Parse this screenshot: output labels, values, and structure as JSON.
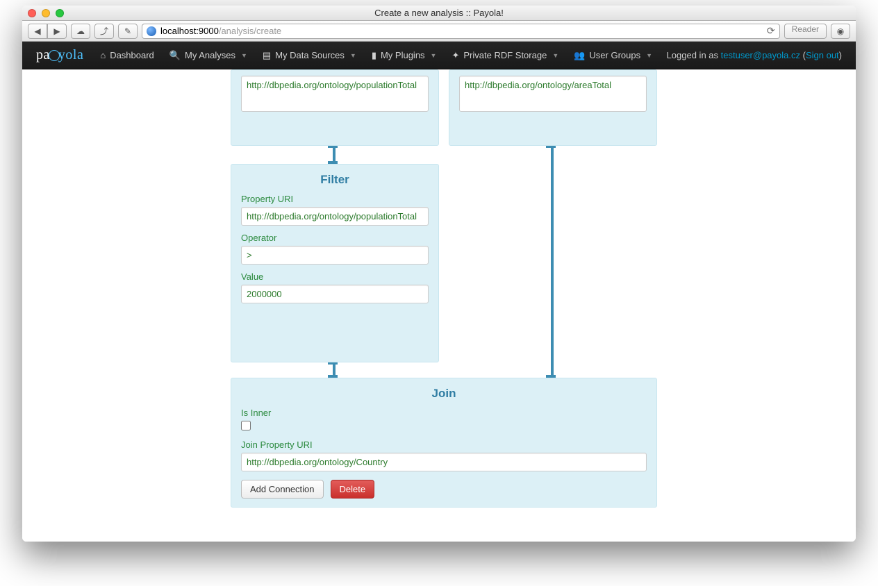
{
  "window": {
    "title": "Create a new analysis :: Payola!",
    "url_host": "localhost:9000",
    "url_path": "/analysis/create",
    "reader_label": "Reader"
  },
  "navbar": {
    "brand": "payola",
    "items": [
      {
        "icon": "home",
        "label": "Dashboard",
        "has_dropdown": false
      },
      {
        "icon": "search",
        "label": "My Analyses",
        "has_dropdown": true
      },
      {
        "icon": "folder",
        "label": "My Data Sources",
        "has_dropdown": true
      },
      {
        "icon": "file",
        "label": "My Plugins",
        "has_dropdown": true
      },
      {
        "icon": "share",
        "label": "Private RDF Storage",
        "has_dropdown": true
      },
      {
        "icon": "users",
        "label": "User Groups",
        "has_dropdown": true
      }
    ],
    "logged_in_prefix": "Logged in as ",
    "user_email": "testuser@payola.cz",
    "sign_out": "Sign out"
  },
  "boxes": {
    "left_top": {
      "textarea_value": "http://dbpedia.org/ontology/populationTotal"
    },
    "right_top": {
      "textarea_value": "http://dbpedia.org/ontology/areaTotal"
    },
    "filter": {
      "title": "Filter",
      "label_property": "Property URI",
      "property_value": "http://dbpedia.org/ontology/populationTotal",
      "label_operator": "Operator",
      "operator_value": ">",
      "label_value": "Value",
      "value_value": "2000000"
    },
    "join": {
      "title": "Join",
      "label_is_inner": "Is Inner",
      "is_inner_checked": false,
      "label_join_property": "Join Property URI",
      "join_property_value": "http://dbpedia.org/ontology/Country",
      "btn_add": "Add Connection",
      "btn_delete": "Delete"
    }
  }
}
